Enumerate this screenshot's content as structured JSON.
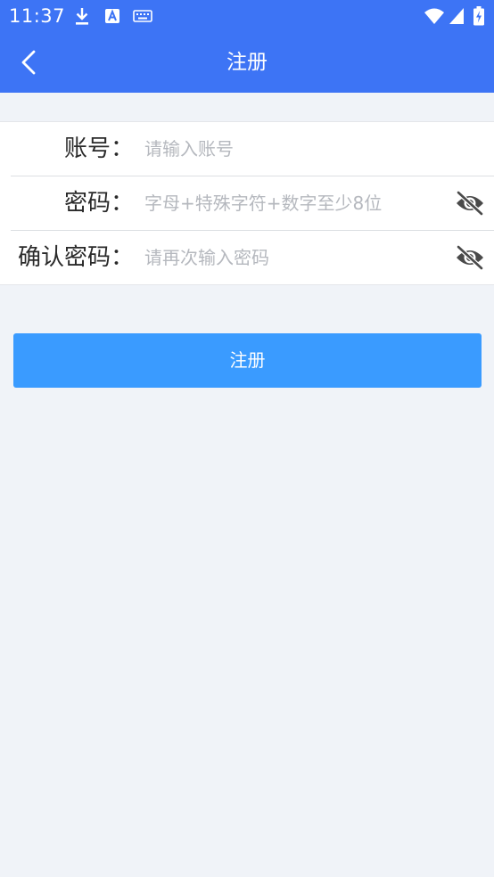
{
  "status_bar": {
    "time": "11:37",
    "icons": [
      "download-icon",
      "translate-a-icon",
      "keyboard-icon",
      "wifi-icon",
      "signal-icon",
      "battery-charging-icon"
    ]
  },
  "navbar": {
    "title": "注册",
    "back_icon": "chevron-left-icon"
  },
  "form": {
    "account": {
      "label": "账号：",
      "placeholder": "请输入账号",
      "value": ""
    },
    "password": {
      "label": "密码：",
      "placeholder": "字母+特殊字符+数字至少8位",
      "value": "",
      "toggle_icon": "eye-off-icon"
    },
    "confirm_password": {
      "label": "确认密码：",
      "placeholder": "请再次输入密码",
      "value": "",
      "toggle_icon": "eye-off-icon"
    }
  },
  "submit": {
    "label": "注册"
  },
  "colors": {
    "header": "#3d74f5",
    "button": "#3a9bff",
    "background": "#f0f3f8"
  }
}
